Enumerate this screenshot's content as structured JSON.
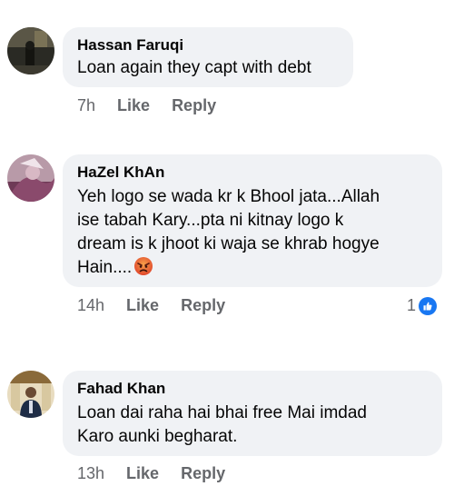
{
  "comments": [
    {
      "author": "Hassan Faruqi",
      "text": "Loan again they capt with debt",
      "time": "7h",
      "like_label": "Like",
      "reply_label": "Reply"
    },
    {
      "author": "HaZel KhAn",
      "text": "Yeh logo se wada kr k Bhool jata...Allah\nise tabah Kary...pta ni kitnay logo k\ndream is k jhoot ki waja se khrab hogye\nHain....",
      "emoji": "angry-face-emoji",
      "time": "14h",
      "like_label": "Like",
      "reply_label": "Reply",
      "reaction_count": "1",
      "reaction_icon": "thumbs-up-icon"
    },
    {
      "author": "Fahad Khan",
      "text": "Loan dai raha hai bhai free Mai imdad\nKaro aunki begharat.",
      "time": "13h",
      "like_label": "Like",
      "reply_label": "Reply"
    }
  ],
  "colors": {
    "bubble": "#f0f2f5",
    "meta_text": "#65676b",
    "like_blue": "#1877f2"
  }
}
